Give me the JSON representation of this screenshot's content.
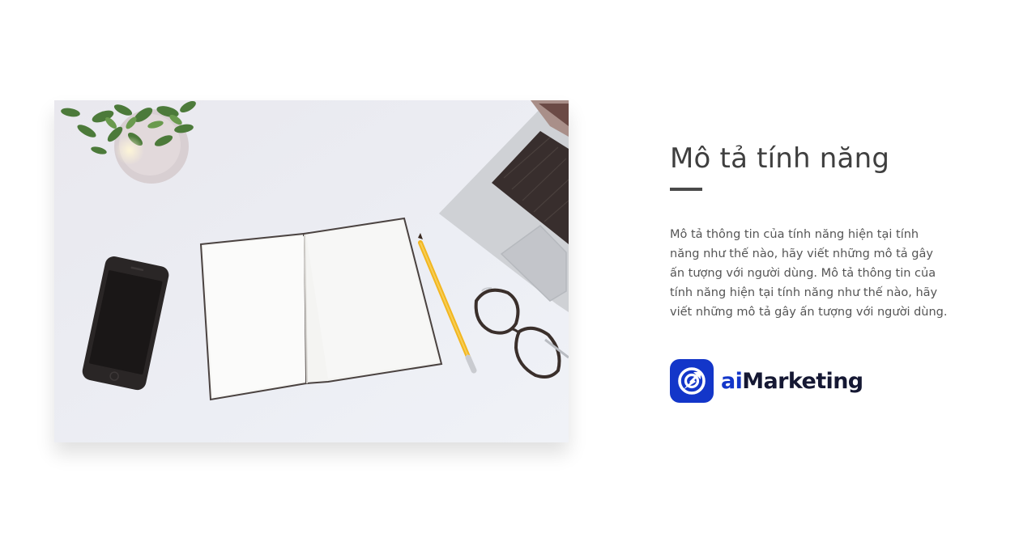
{
  "feature": {
    "title": "Mô tả tính năng",
    "description": "Mô tả thông tin của tính năng hiện tại tính năng như thế nào, hãy viết những mô tả gây ấn tượng với người dùng. Mô tả thông tin của tính năng hiện tại tính năng như thế nào, hãy viết những mô tả gây ấn tượng với người dùng."
  },
  "brand": {
    "name_prefix": "ai",
    "name_suffix": "Marketing",
    "icon": "rocket-target-icon",
    "color": "#1336c9",
    "text_color": "#151833"
  },
  "image": {
    "subject": "desk-workspace-photo",
    "items": [
      "plant-icon",
      "smartphone-icon",
      "notebook-icon",
      "pencil-icon",
      "glasses-icon",
      "laptop-icon"
    ]
  }
}
